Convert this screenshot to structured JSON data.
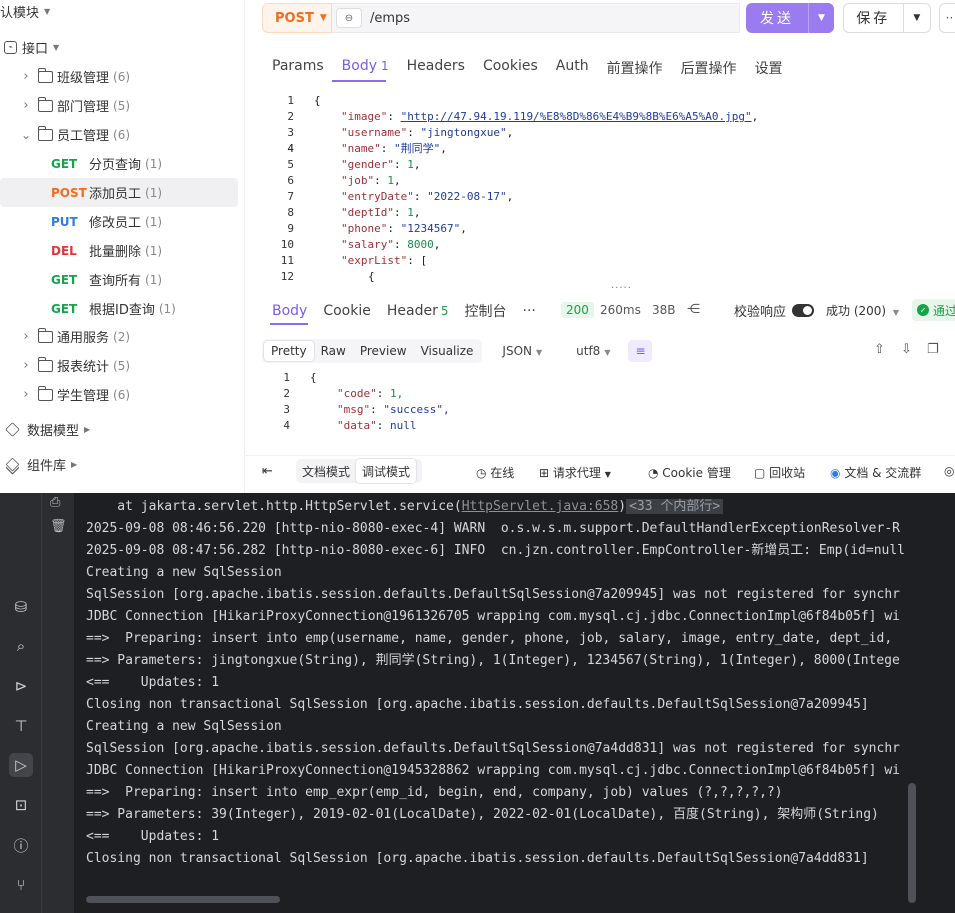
{
  "sidebar": {
    "top_module": "认模块",
    "interface_group": "接口",
    "folders_top": [
      {
        "label": "班级管理",
        "count": "(6)"
      },
      {
        "label": "部门管理",
        "count": "(5)"
      },
      {
        "label": "员工管理",
        "count": "(6)"
      }
    ],
    "endpoints": [
      {
        "method": "GET",
        "label": "分页查询",
        "count": "(1)"
      },
      {
        "method": "POST",
        "label": "添加员工",
        "count": "(1)"
      },
      {
        "method": "PUT",
        "label": "修改员工",
        "count": "(1)"
      },
      {
        "method": "DEL",
        "label": "批量删除",
        "count": "(1)"
      },
      {
        "method": "GET",
        "label": "查询所有",
        "count": "(1)"
      },
      {
        "method": "GET",
        "label": "根据ID查询",
        "count": "(1)"
      }
    ],
    "folders_bottom": [
      {
        "label": "通用服务",
        "count": "(2)"
      },
      {
        "label": "报表统计",
        "count": "(5)"
      },
      {
        "label": "学生管理",
        "count": "(6)"
      }
    ],
    "data_model": "数据模型",
    "component_lib": "组件库"
  },
  "request": {
    "method": "POST",
    "url": "/emps",
    "send_label": "发送",
    "save_label": "保存",
    "tabs": [
      {
        "label": "Params"
      },
      {
        "label": "Body",
        "badge": "1"
      },
      {
        "label": "Headers"
      },
      {
        "label": "Cookies"
      },
      {
        "label": "Auth"
      },
      {
        "label": "前置操作"
      },
      {
        "label": "后置操作"
      },
      {
        "label": "设置"
      }
    ],
    "body_lines": [
      {
        "n": "1",
        "t": "{"
      },
      {
        "n": "2",
        "k": "\"image\"",
        "v": "\"http://47.94.19.119/%E8%8D%86%E4%B9%8B%E6%A5%A0.jpg\"",
        "vt": "u"
      },
      {
        "n": "3",
        "k": "\"username\"",
        "v": "\"jingtongxue\"",
        "vt": "s"
      },
      {
        "n": "4",
        "k": "\"name\"",
        "v": "\"荆同学\"",
        "vt": "s"
      },
      {
        "n": "5",
        "k": "\"gender\"",
        "v": "1",
        "vt": "n"
      },
      {
        "n": "6",
        "k": "\"job\"",
        "v": "1",
        "vt": "n"
      },
      {
        "n": "7",
        "k": "\"entryDate\"",
        "v": "\"2022-08-17\"",
        "vt": "s"
      },
      {
        "n": "8",
        "k": "\"deptId\"",
        "v": "1",
        "vt": "n"
      },
      {
        "n": "9",
        "k": "\"phone\"",
        "v": "\"1234567\"",
        "vt": "s"
      },
      {
        "n": "10",
        "k": "\"salary\"",
        "v": "8000",
        "vt": "n"
      },
      {
        "n": "11",
        "k": "\"exprList\"",
        "v": "[",
        "vt": "p"
      },
      {
        "n": "12",
        "t": "{"
      }
    ]
  },
  "response": {
    "tabs": [
      {
        "label": "Body"
      },
      {
        "label": "Cookie"
      },
      {
        "label": "Header",
        "badge": "5"
      },
      {
        "label": "控制台"
      }
    ],
    "more": "···",
    "status_code": "200",
    "time": "260ms",
    "size": "38B",
    "validate_label": "校验响应",
    "result_label": "成功 (200)",
    "pass_label": "通过",
    "formats": [
      "Pretty",
      "Raw",
      "Preview",
      "Visualize"
    ],
    "lang": "JSON",
    "encoding": "utf8",
    "body_lines": [
      {
        "n": "1",
        "t": "{"
      },
      {
        "n": "2",
        "k": "\"code\"",
        "v": "1,",
        "vt": "n"
      },
      {
        "n": "3",
        "k": "\"msg\"",
        "v": "\"success\",",
        "vt": "s"
      },
      {
        "n": "4",
        "k": "\"data\"",
        "v": "null",
        "vt": "s"
      }
    ]
  },
  "footer": {
    "doc_mode": "文档模式",
    "debug_mode": "调试模式",
    "online": "在线",
    "proxy": "请求代理",
    "cookie_mgmt": "Cookie 管理",
    "recycle": "回收站",
    "docs_community": "文档 & 交流群"
  },
  "console": {
    "lines": [
      {
        "pre": "    at jakarta.servlet.http.HttpServlet.service(",
        "link": "HttpServlet.java:658",
        "post": ")",
        "fold": "<33 个内部行>"
      },
      {
        "text": "2025-09-08 08:46:56.220 [http-nio-8080-exec-4] WARN  o.s.w.s.m.support.DefaultHandlerExceptionResolver-R"
      },
      {
        "text": "2025-09-08 08:47:56.282 [http-nio-8080-exec-6] INFO  cn.jzn.controller.EmpController-新增员工: Emp(id=null"
      },
      {
        "text": "Creating a new SqlSession"
      },
      {
        "text": "SqlSession [org.apache.ibatis.session.defaults.DefaultSqlSession@7a209945] was not registered for synchr"
      },
      {
        "text": "JDBC Connection [HikariProxyConnection@1961326705 wrapping com.mysql.cj.jdbc.ConnectionImpl@6f84b05f] wi"
      },
      {
        "text": "==>  Preparing: insert into emp(username, name, gender, phone, job, salary, image, entry_date, dept_id,"
      },
      {
        "text": "==> Parameters: jingtongxue(String), 荆同学(String), 1(Integer), 1234567(String), 1(Integer), 8000(Intege"
      },
      {
        "text": "<==    Updates: 1"
      },
      {
        "text": "Closing non transactional SqlSession [org.apache.ibatis.session.defaults.DefaultSqlSession@7a209945]"
      },
      {
        "text": "Creating a new SqlSession"
      },
      {
        "text": "SqlSession [org.apache.ibatis.session.defaults.DefaultSqlSession@7a4dd831] was not registered for synchr"
      },
      {
        "text": "JDBC Connection [HikariProxyConnection@1945328862 wrapping com.mysql.cj.jdbc.ConnectionImpl@6f84b05f] wi"
      },
      {
        "text": "==>  Preparing: insert into emp_expr(emp_id, begin, end, company, job) values (?,?,?,?,?)"
      },
      {
        "text": "==> Parameters: 39(Integer), 2019-02-01(LocalDate), 2022-02-01(LocalDate), 百度(String), 架构师(String)"
      },
      {
        "text": "<==    Updates: 1"
      },
      {
        "text": "Closing non transactional SqlSession [org.apache.ibatis.session.defaults.DefaultSqlSession@7a4dd831]"
      }
    ]
  },
  "colors": {
    "accent": "#8b6cf0",
    "get": "#17a34a",
    "post": "#f26b1f",
    "put": "#2f7de1",
    "del": "#e5333a",
    "console_bg": "#1e1f22"
  }
}
